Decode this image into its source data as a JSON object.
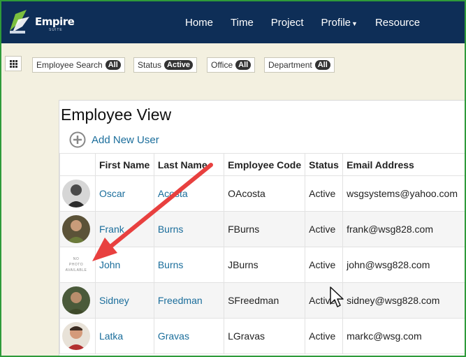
{
  "app": {
    "logo_text": "Empire",
    "logo_sub": "SUITE"
  },
  "nav": {
    "items": [
      {
        "label": "Home"
      },
      {
        "label": "Time"
      },
      {
        "label": "Project"
      },
      {
        "label": "Profile",
        "has_caret": true
      },
      {
        "label": "Resource"
      }
    ]
  },
  "filters": [
    {
      "label": "Employee Search",
      "value": "All"
    },
    {
      "label": "Status",
      "value": "Active"
    },
    {
      "label": "Office",
      "value": "All"
    },
    {
      "label": "Department",
      "value": "All"
    }
  ],
  "panel": {
    "title": "Employee View",
    "add_user_label": "Add New User"
  },
  "table": {
    "columns": [
      "First Name",
      "Last Name",
      "Employee Code",
      "Status",
      "Email Address"
    ],
    "rows": [
      {
        "first": "Oscar",
        "last": "Acosta",
        "code": "OAcosta",
        "status": "Active",
        "email": "wsgsystems@yahoo.com",
        "photo": "photo"
      },
      {
        "first": "Frank",
        "last": "Burns",
        "code": "FBurns",
        "status": "Active",
        "email": "frank@wsg828.com",
        "photo": "photo"
      },
      {
        "first": "John",
        "last": "Burns",
        "code": "JBurns",
        "status": "Active",
        "email": "john@wsg828.com",
        "photo": "none",
        "no_photo_lines": [
          "NO",
          "PHOTO",
          "AVAILABLE"
        ]
      },
      {
        "first": "Sidney",
        "last": "Freedman",
        "code": "SFreedman",
        "status": "Active",
        "email": "sidney@wsg828.com",
        "photo": "photo"
      },
      {
        "first": "Latka",
        "last": "Gravas",
        "code": "LGravas",
        "status": "Active",
        "email": "markc@wsg.com",
        "photo": "photo"
      }
    ]
  },
  "colors": {
    "nav_bg": "#0e2e57",
    "link": "#1a6d9b",
    "frame_border": "#2e9a3a",
    "arrow": "#e8403f"
  }
}
